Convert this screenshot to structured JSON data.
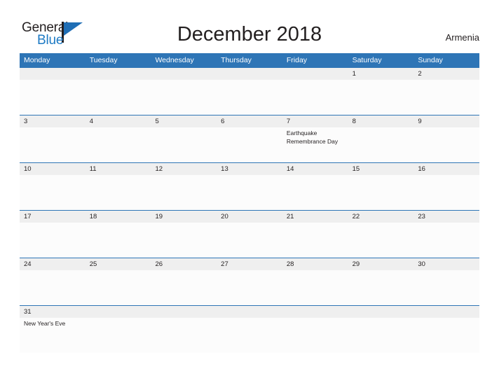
{
  "logo": {
    "word_top": "General",
    "word_bottom": "Blue",
    "flag_icon": "flag-triangle-icon",
    "accent_color": "#1d7ac4"
  },
  "header": {
    "title": "December 2018",
    "country": "Armenia"
  },
  "theme": {
    "header_blue": "#2e75b6",
    "date_band_gray": "#efefef",
    "cell_white": "#fcfcfc",
    "text_dark": "#231f20"
  },
  "calendar": {
    "weekdays": [
      "Monday",
      "Tuesday",
      "Wednesday",
      "Thursday",
      "Friday",
      "Saturday",
      "Sunday"
    ],
    "weeks": [
      {
        "days": [
          {
            "num": "",
            "event": ""
          },
          {
            "num": "",
            "event": ""
          },
          {
            "num": "",
            "event": ""
          },
          {
            "num": "",
            "event": ""
          },
          {
            "num": "",
            "event": ""
          },
          {
            "num": "1",
            "event": ""
          },
          {
            "num": "2",
            "event": ""
          }
        ]
      },
      {
        "days": [
          {
            "num": "3",
            "event": ""
          },
          {
            "num": "4",
            "event": ""
          },
          {
            "num": "5",
            "event": ""
          },
          {
            "num": "6",
            "event": ""
          },
          {
            "num": "7",
            "event": "Earthquake Remembrance Day"
          },
          {
            "num": "8",
            "event": ""
          },
          {
            "num": "9",
            "event": ""
          }
        ]
      },
      {
        "days": [
          {
            "num": "10",
            "event": ""
          },
          {
            "num": "11",
            "event": ""
          },
          {
            "num": "12",
            "event": ""
          },
          {
            "num": "13",
            "event": ""
          },
          {
            "num": "14",
            "event": ""
          },
          {
            "num": "15",
            "event": ""
          },
          {
            "num": "16",
            "event": ""
          }
        ]
      },
      {
        "days": [
          {
            "num": "17",
            "event": ""
          },
          {
            "num": "18",
            "event": ""
          },
          {
            "num": "19",
            "event": ""
          },
          {
            "num": "20",
            "event": ""
          },
          {
            "num": "21",
            "event": ""
          },
          {
            "num": "22",
            "event": ""
          },
          {
            "num": "23",
            "event": ""
          }
        ]
      },
      {
        "days": [
          {
            "num": "24",
            "event": ""
          },
          {
            "num": "25",
            "event": ""
          },
          {
            "num": "26",
            "event": ""
          },
          {
            "num": "27",
            "event": ""
          },
          {
            "num": "28",
            "event": ""
          },
          {
            "num": "29",
            "event": ""
          },
          {
            "num": "30",
            "event": ""
          }
        ]
      },
      {
        "days": [
          {
            "num": "31",
            "event": "New Year's Eve"
          },
          {
            "num": "",
            "event": ""
          },
          {
            "num": "",
            "event": ""
          },
          {
            "num": "",
            "event": ""
          },
          {
            "num": "",
            "event": ""
          },
          {
            "num": "",
            "event": ""
          },
          {
            "num": "",
            "event": ""
          }
        ]
      }
    ]
  }
}
